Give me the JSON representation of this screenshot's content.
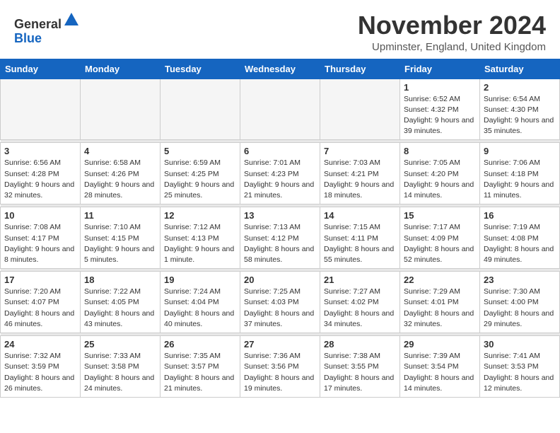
{
  "header": {
    "logo_general": "General",
    "logo_blue": "Blue",
    "month_title": "November 2024",
    "location": "Upminster, England, United Kingdom"
  },
  "weekdays": [
    "Sunday",
    "Monday",
    "Tuesday",
    "Wednesday",
    "Thursday",
    "Friday",
    "Saturday"
  ],
  "weeks": [
    [
      {
        "day": "",
        "info": ""
      },
      {
        "day": "",
        "info": ""
      },
      {
        "day": "",
        "info": ""
      },
      {
        "day": "",
        "info": ""
      },
      {
        "day": "",
        "info": ""
      },
      {
        "day": "1",
        "info": "Sunrise: 6:52 AM\nSunset: 4:32 PM\nDaylight: 9 hours and 39 minutes."
      },
      {
        "day": "2",
        "info": "Sunrise: 6:54 AM\nSunset: 4:30 PM\nDaylight: 9 hours and 35 minutes."
      }
    ],
    [
      {
        "day": "3",
        "info": "Sunrise: 6:56 AM\nSunset: 4:28 PM\nDaylight: 9 hours and 32 minutes."
      },
      {
        "day": "4",
        "info": "Sunrise: 6:58 AM\nSunset: 4:26 PM\nDaylight: 9 hours and 28 minutes."
      },
      {
        "day": "5",
        "info": "Sunrise: 6:59 AM\nSunset: 4:25 PM\nDaylight: 9 hours and 25 minutes."
      },
      {
        "day": "6",
        "info": "Sunrise: 7:01 AM\nSunset: 4:23 PM\nDaylight: 9 hours and 21 minutes."
      },
      {
        "day": "7",
        "info": "Sunrise: 7:03 AM\nSunset: 4:21 PM\nDaylight: 9 hours and 18 minutes."
      },
      {
        "day": "8",
        "info": "Sunrise: 7:05 AM\nSunset: 4:20 PM\nDaylight: 9 hours and 14 minutes."
      },
      {
        "day": "9",
        "info": "Sunrise: 7:06 AM\nSunset: 4:18 PM\nDaylight: 9 hours and 11 minutes."
      }
    ],
    [
      {
        "day": "10",
        "info": "Sunrise: 7:08 AM\nSunset: 4:17 PM\nDaylight: 9 hours and 8 minutes."
      },
      {
        "day": "11",
        "info": "Sunrise: 7:10 AM\nSunset: 4:15 PM\nDaylight: 9 hours and 5 minutes."
      },
      {
        "day": "12",
        "info": "Sunrise: 7:12 AM\nSunset: 4:13 PM\nDaylight: 9 hours and 1 minute."
      },
      {
        "day": "13",
        "info": "Sunrise: 7:13 AM\nSunset: 4:12 PM\nDaylight: 8 hours and 58 minutes."
      },
      {
        "day": "14",
        "info": "Sunrise: 7:15 AM\nSunset: 4:11 PM\nDaylight: 8 hours and 55 minutes."
      },
      {
        "day": "15",
        "info": "Sunrise: 7:17 AM\nSunset: 4:09 PM\nDaylight: 8 hours and 52 minutes."
      },
      {
        "day": "16",
        "info": "Sunrise: 7:19 AM\nSunset: 4:08 PM\nDaylight: 8 hours and 49 minutes."
      }
    ],
    [
      {
        "day": "17",
        "info": "Sunrise: 7:20 AM\nSunset: 4:07 PM\nDaylight: 8 hours and 46 minutes."
      },
      {
        "day": "18",
        "info": "Sunrise: 7:22 AM\nSunset: 4:05 PM\nDaylight: 8 hours and 43 minutes."
      },
      {
        "day": "19",
        "info": "Sunrise: 7:24 AM\nSunset: 4:04 PM\nDaylight: 8 hours and 40 minutes."
      },
      {
        "day": "20",
        "info": "Sunrise: 7:25 AM\nSunset: 4:03 PM\nDaylight: 8 hours and 37 minutes."
      },
      {
        "day": "21",
        "info": "Sunrise: 7:27 AM\nSunset: 4:02 PM\nDaylight: 8 hours and 34 minutes."
      },
      {
        "day": "22",
        "info": "Sunrise: 7:29 AM\nSunset: 4:01 PM\nDaylight: 8 hours and 32 minutes."
      },
      {
        "day": "23",
        "info": "Sunrise: 7:30 AM\nSunset: 4:00 PM\nDaylight: 8 hours and 29 minutes."
      }
    ],
    [
      {
        "day": "24",
        "info": "Sunrise: 7:32 AM\nSunset: 3:59 PM\nDaylight: 8 hours and 26 minutes."
      },
      {
        "day": "25",
        "info": "Sunrise: 7:33 AM\nSunset: 3:58 PM\nDaylight: 8 hours and 24 minutes."
      },
      {
        "day": "26",
        "info": "Sunrise: 7:35 AM\nSunset: 3:57 PM\nDaylight: 8 hours and 21 minutes."
      },
      {
        "day": "27",
        "info": "Sunrise: 7:36 AM\nSunset: 3:56 PM\nDaylight: 8 hours and 19 minutes."
      },
      {
        "day": "28",
        "info": "Sunrise: 7:38 AM\nSunset: 3:55 PM\nDaylight: 8 hours and 17 minutes."
      },
      {
        "day": "29",
        "info": "Sunrise: 7:39 AM\nSunset: 3:54 PM\nDaylight: 8 hours and 14 minutes."
      },
      {
        "day": "30",
        "info": "Sunrise: 7:41 AM\nSunset: 3:53 PM\nDaylight: 8 hours and 12 minutes."
      }
    ]
  ]
}
